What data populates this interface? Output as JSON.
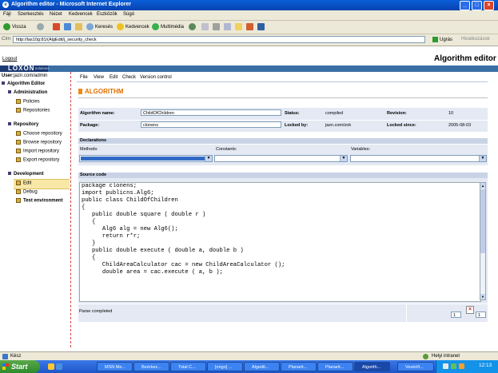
{
  "window": {
    "title": "Algorithm editor - Microsoft Internet Explorer"
  },
  "ie_menu": [
    "Fájl",
    "Szerkesztés",
    "Nézet",
    "Kedvencek",
    "Eszközök",
    "Súgó"
  ],
  "ie_toolbar": {
    "back": "Vissza",
    "search": "Keresés",
    "favorites": "Kedvencek",
    "media": "Multimédia"
  },
  "address": {
    "label": "Cím",
    "url": "http://las10g:81/(AlgEdit/j_security_check",
    "go": "Ugrás",
    "links": "Hivatkozások"
  },
  "page": {
    "logout": "Logout",
    "logo": "LOXON",
    "logo_sub": "solutions",
    "app_title": "Algorithm editor",
    "user_label": "User:",
    "user": "jazn.com/admin"
  },
  "sidebar": {
    "root": "Algorithm Editor",
    "groups": [
      {
        "title": "Administration",
        "items": [
          "Policies",
          "Repositories"
        ]
      },
      {
        "title": "Repository",
        "items": [
          "Choose repository",
          "Browse repository",
          "Import repository",
          "Export repository"
        ]
      },
      {
        "title": "Development",
        "items": [
          "Edit",
          "Debug",
          "Test environment"
        ]
      }
    ]
  },
  "app_menu": [
    "File",
    "View",
    "Edit",
    "Check",
    "Version control"
  ],
  "section_title": "ALGORITHM",
  "algorithm": {
    "name_label": "Algorithm name:",
    "name_value": "ChildOfChildren",
    "status_label": "Status:",
    "status_value": "compiled",
    "revision_label": "Revision:",
    "revision_value": "10",
    "package_label": "Package:",
    "package_value": "clonens",
    "locked_by_label": "Locked by:",
    "locked_by_value": "jazn.com/zok",
    "locked_since_label": "Locked since:",
    "locked_since_value": "2005-08-03"
  },
  "declarations": {
    "title": "Declarations",
    "methods": "Methods:",
    "constants": "Constants:",
    "variables": "Variables:"
  },
  "source": {
    "title": "Source code",
    "lines": [
      "package clonens;",
      "",
      "import publicns.Alg6;",
      "",
      "public class ChildOfChildren",
      "{",
      "   public double square ( double r )",
      "   {",
      "      Alg6 alg = new Alg6();",
      "      return r*r;",
      "   }",
      "",
      "   public double execute ( double a, double b )",
      "   {",
      "      ChildAreaCalculator cac = new ChildAreaCalculator ();",
      "      double area = cac.execute ( a, b );"
    ]
  },
  "parse_status": "Parse completed",
  "pos": {
    "line": "1",
    "col": "1"
  },
  "statusbar": {
    "left": "Kész",
    "right": "Helyi intranet"
  },
  "taskbar": {
    "start": "Start",
    "tasks": [
      "MSN Me...",
      "Beérkez...",
      "Total C...",
      "[origo] ...",
      "Algedit...",
      "Planarit...",
      "Planarit...",
      "Algorith..."
    ],
    "tray_text": "Vezérlő...",
    "clock": "12:13"
  }
}
